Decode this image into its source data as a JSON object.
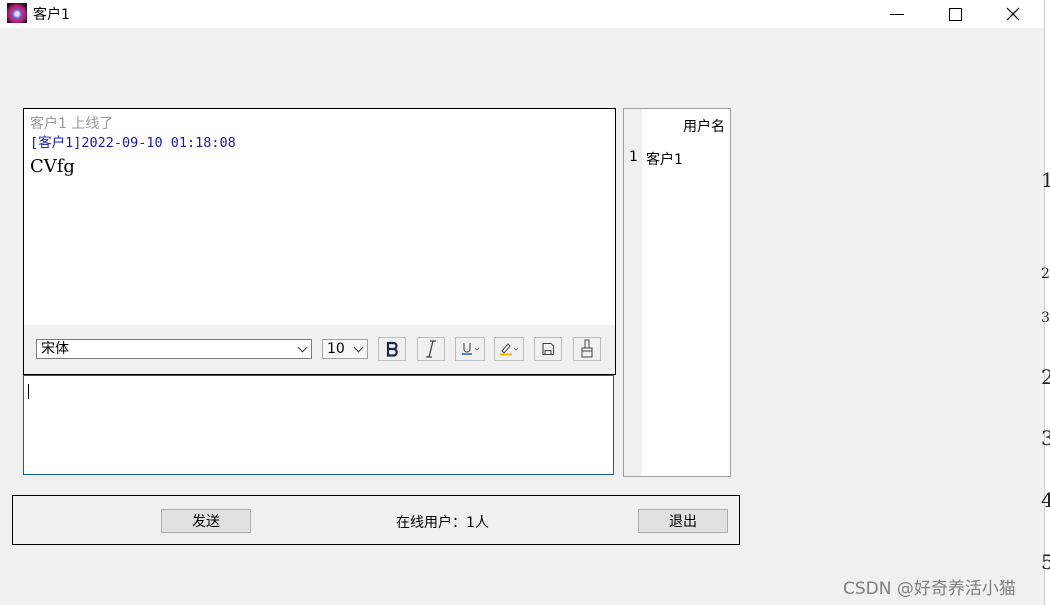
{
  "window": {
    "title": "客户1"
  },
  "chat": {
    "system_message": "客户1 上线了",
    "message_header": "[客户1]2022-09-10 01:18:08",
    "message_body": "CVfg"
  },
  "toolbar": {
    "font_value": "宋体",
    "size_value": "10"
  },
  "user_list": {
    "header": "用户名",
    "rows": [
      {
        "num": "1",
        "name": "客户1"
      }
    ]
  },
  "bottom": {
    "send_label": "发送",
    "online_status": "在线用户：1人",
    "exit_label": "退出"
  },
  "background_strip": {
    "glyphs": [
      "1",
      "2",
      "3",
      "2",
      "3",
      "4",
      "5"
    ]
  },
  "watermark": "CSDN @好奇养活小猫"
}
